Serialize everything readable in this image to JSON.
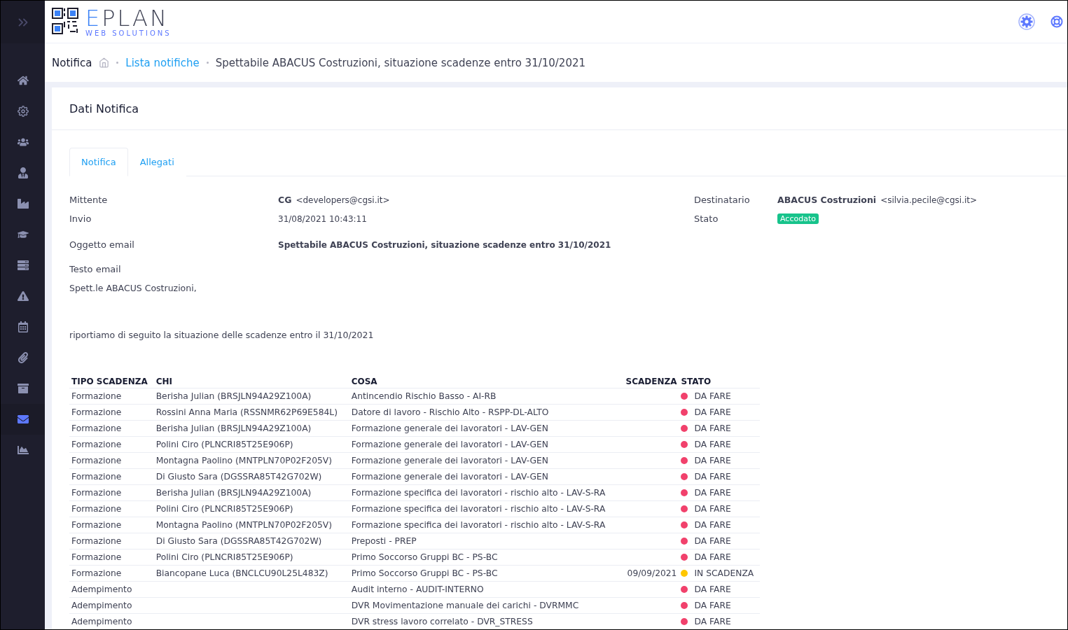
{
  "logo": {
    "wordmark": "EPLAN",
    "tagline": "WEB SOLUTIONS"
  },
  "sidebar": {
    "items": [
      {
        "selected": false
      },
      {
        "selected": false
      },
      {
        "selected": false
      },
      {
        "selected": false
      },
      {
        "selected": false
      },
      {
        "selected": false
      },
      {
        "selected": false
      },
      {
        "selected": false
      },
      {
        "selected": false
      },
      {
        "selected": false
      },
      {
        "selected": false
      },
      {
        "selected": true
      },
      {
        "selected": false
      }
    ]
  },
  "breadcrumb": {
    "title": "Notifica",
    "link": "Lista notifiche",
    "current": "Spettabile ABACUS Costruzioni, situazione scadenze entro 31/10/2021"
  },
  "card": {
    "title": "Dati Notifica"
  },
  "tabs": [
    {
      "label": "Notifica",
      "selected": true
    },
    {
      "label": "Allegati",
      "selected": false
    }
  ],
  "fields": {
    "mittente_label": "Mittente",
    "mittente_name": "CG",
    "mittente_email": "<developers@cgsi.it>",
    "invio_label": "Invio",
    "invio_value": "31/08/2021 10:43:11",
    "destinatario_label": "Destinatario",
    "destinatario_name": "ABACUS Costruzioni",
    "destinatario_email": "<silvia.pecile@cgsi.it>",
    "stato_label": "Stato",
    "stato_value": "Accodato",
    "oggetto_label": "Oggetto email",
    "oggetto_value": "Spettabile ABACUS Costruzioni, situazione scadenze entro 31/10/2021",
    "testo_label": "Testo email"
  },
  "email_body": [
    "Spett.le ABACUS Costruzioni,",
    "riportiamo di seguito la situazione delle scadenze entro il 31/10/2021"
  ],
  "table": {
    "columns": [
      "TIPO SCADENZA",
      "CHI",
      "COSA",
      "SCADENZA",
      "STATO"
    ],
    "rows": [
      {
        "tipo": "Formazione",
        "chi": "Berisha Julian (BRSJLN94A29Z100A)",
        "cosa": "Antincendio Rischio Basso - AI-RB",
        "stato": "DA FARE",
        "color": "#f1416c"
      },
      {
        "tipo": "Formazione",
        "chi": "Rossini Anna Maria (RSSNMR62P69E584L)",
        "cosa": "Datore di lavoro - Rischio Alto - RSPP-DL-ALTO",
        "stato": "DA FARE",
        "color": "#f1416c"
      },
      {
        "tipo": "Formazione",
        "chi": "Berisha Julian (BRSJLN94A29Z100A)",
        "cosa": "Formazione generale dei lavoratori - LAV-GEN",
        "stato": "DA FARE",
        "color": "#f1416c"
      },
      {
        "tipo": "Formazione",
        "chi": "Polini Ciro (PLNCRI85T25E906P)",
        "cosa": "Formazione generale dei lavoratori - LAV-GEN",
        "stato": "DA FARE",
        "color": "#f1416c"
      },
      {
        "tipo": "Formazione",
        "chi": "Montagna Paolino (MNTPLN70P02F205V)",
        "cosa": "Formazione generale dei lavoratori - LAV-GEN",
        "stato": "DA FARE",
        "color": "#f1416c"
      },
      {
        "tipo": "Formazione",
        "chi": "Di Giusto Sara (DGSSRA85T42G702W)",
        "cosa": "Formazione generale dei lavoratori - LAV-GEN",
        "stato": "DA FARE",
        "color": "#f1416c"
      },
      {
        "tipo": "Formazione",
        "chi": "Berisha Julian (BRSJLN94A29Z100A)",
        "cosa": "Formazione specifica dei lavoratori - rischio alto - LAV-S-RA",
        "stato": "DA FARE",
        "color": "#f1416c"
      },
      {
        "tipo": "Formazione",
        "chi": "Polini Ciro (PLNCRI85T25E906P)",
        "cosa": "Formazione specifica dei lavoratori - rischio alto - LAV-S-RA",
        "stato": "DA FARE",
        "color": "#f1416c"
      },
      {
        "tipo": "Formazione",
        "chi": "Montagna Paolino (MNTPLN70P02F205V)",
        "cosa": "Formazione specifica dei lavoratori - rischio alto - LAV-S-RA",
        "stato": "DA FARE",
        "color": "#f1416c"
      },
      {
        "tipo": "Formazione",
        "chi": "Di Giusto Sara (DGSSRA85T42G702W)",
        "cosa": "Preposti - PREP",
        "stato": "DA FARE",
        "color": "#f1416c"
      },
      {
        "tipo": "Formazione",
        "chi": "Polini Ciro (PLNCRI85T25E906P)",
        "cosa": "Primo Soccorso Gruppi BC - PS-BC",
        "stato": "DA FARE",
        "color": "#f1416c"
      },
      {
        "tipo": "Formazione",
        "chi": "Biancopane Luca (BNCLCU90L25L483Z)",
        "cosa": "Primo Soccorso Gruppi BC - PS-BC",
        "scadenza": "09/09/2021",
        "stato": "IN SCADENZA",
        "color": "#ffc700"
      },
      {
        "tipo": "Adempimento",
        "cosa": "Audit interno - AUDIT-INTERNO",
        "stato": "DA FARE",
        "color": "#f1416c"
      },
      {
        "tipo": "Adempimento",
        "cosa": "DVR Movimentazione manuale dei carichi - DVRMMC",
        "stato": "DA FARE",
        "color": "#f1416c"
      },
      {
        "tipo": "Adempimento",
        "cosa": "DVR stress lavoro correlato - DVR_STRESS",
        "stato": "DA FARE",
        "color": "#f1416c"
      }
    ]
  }
}
